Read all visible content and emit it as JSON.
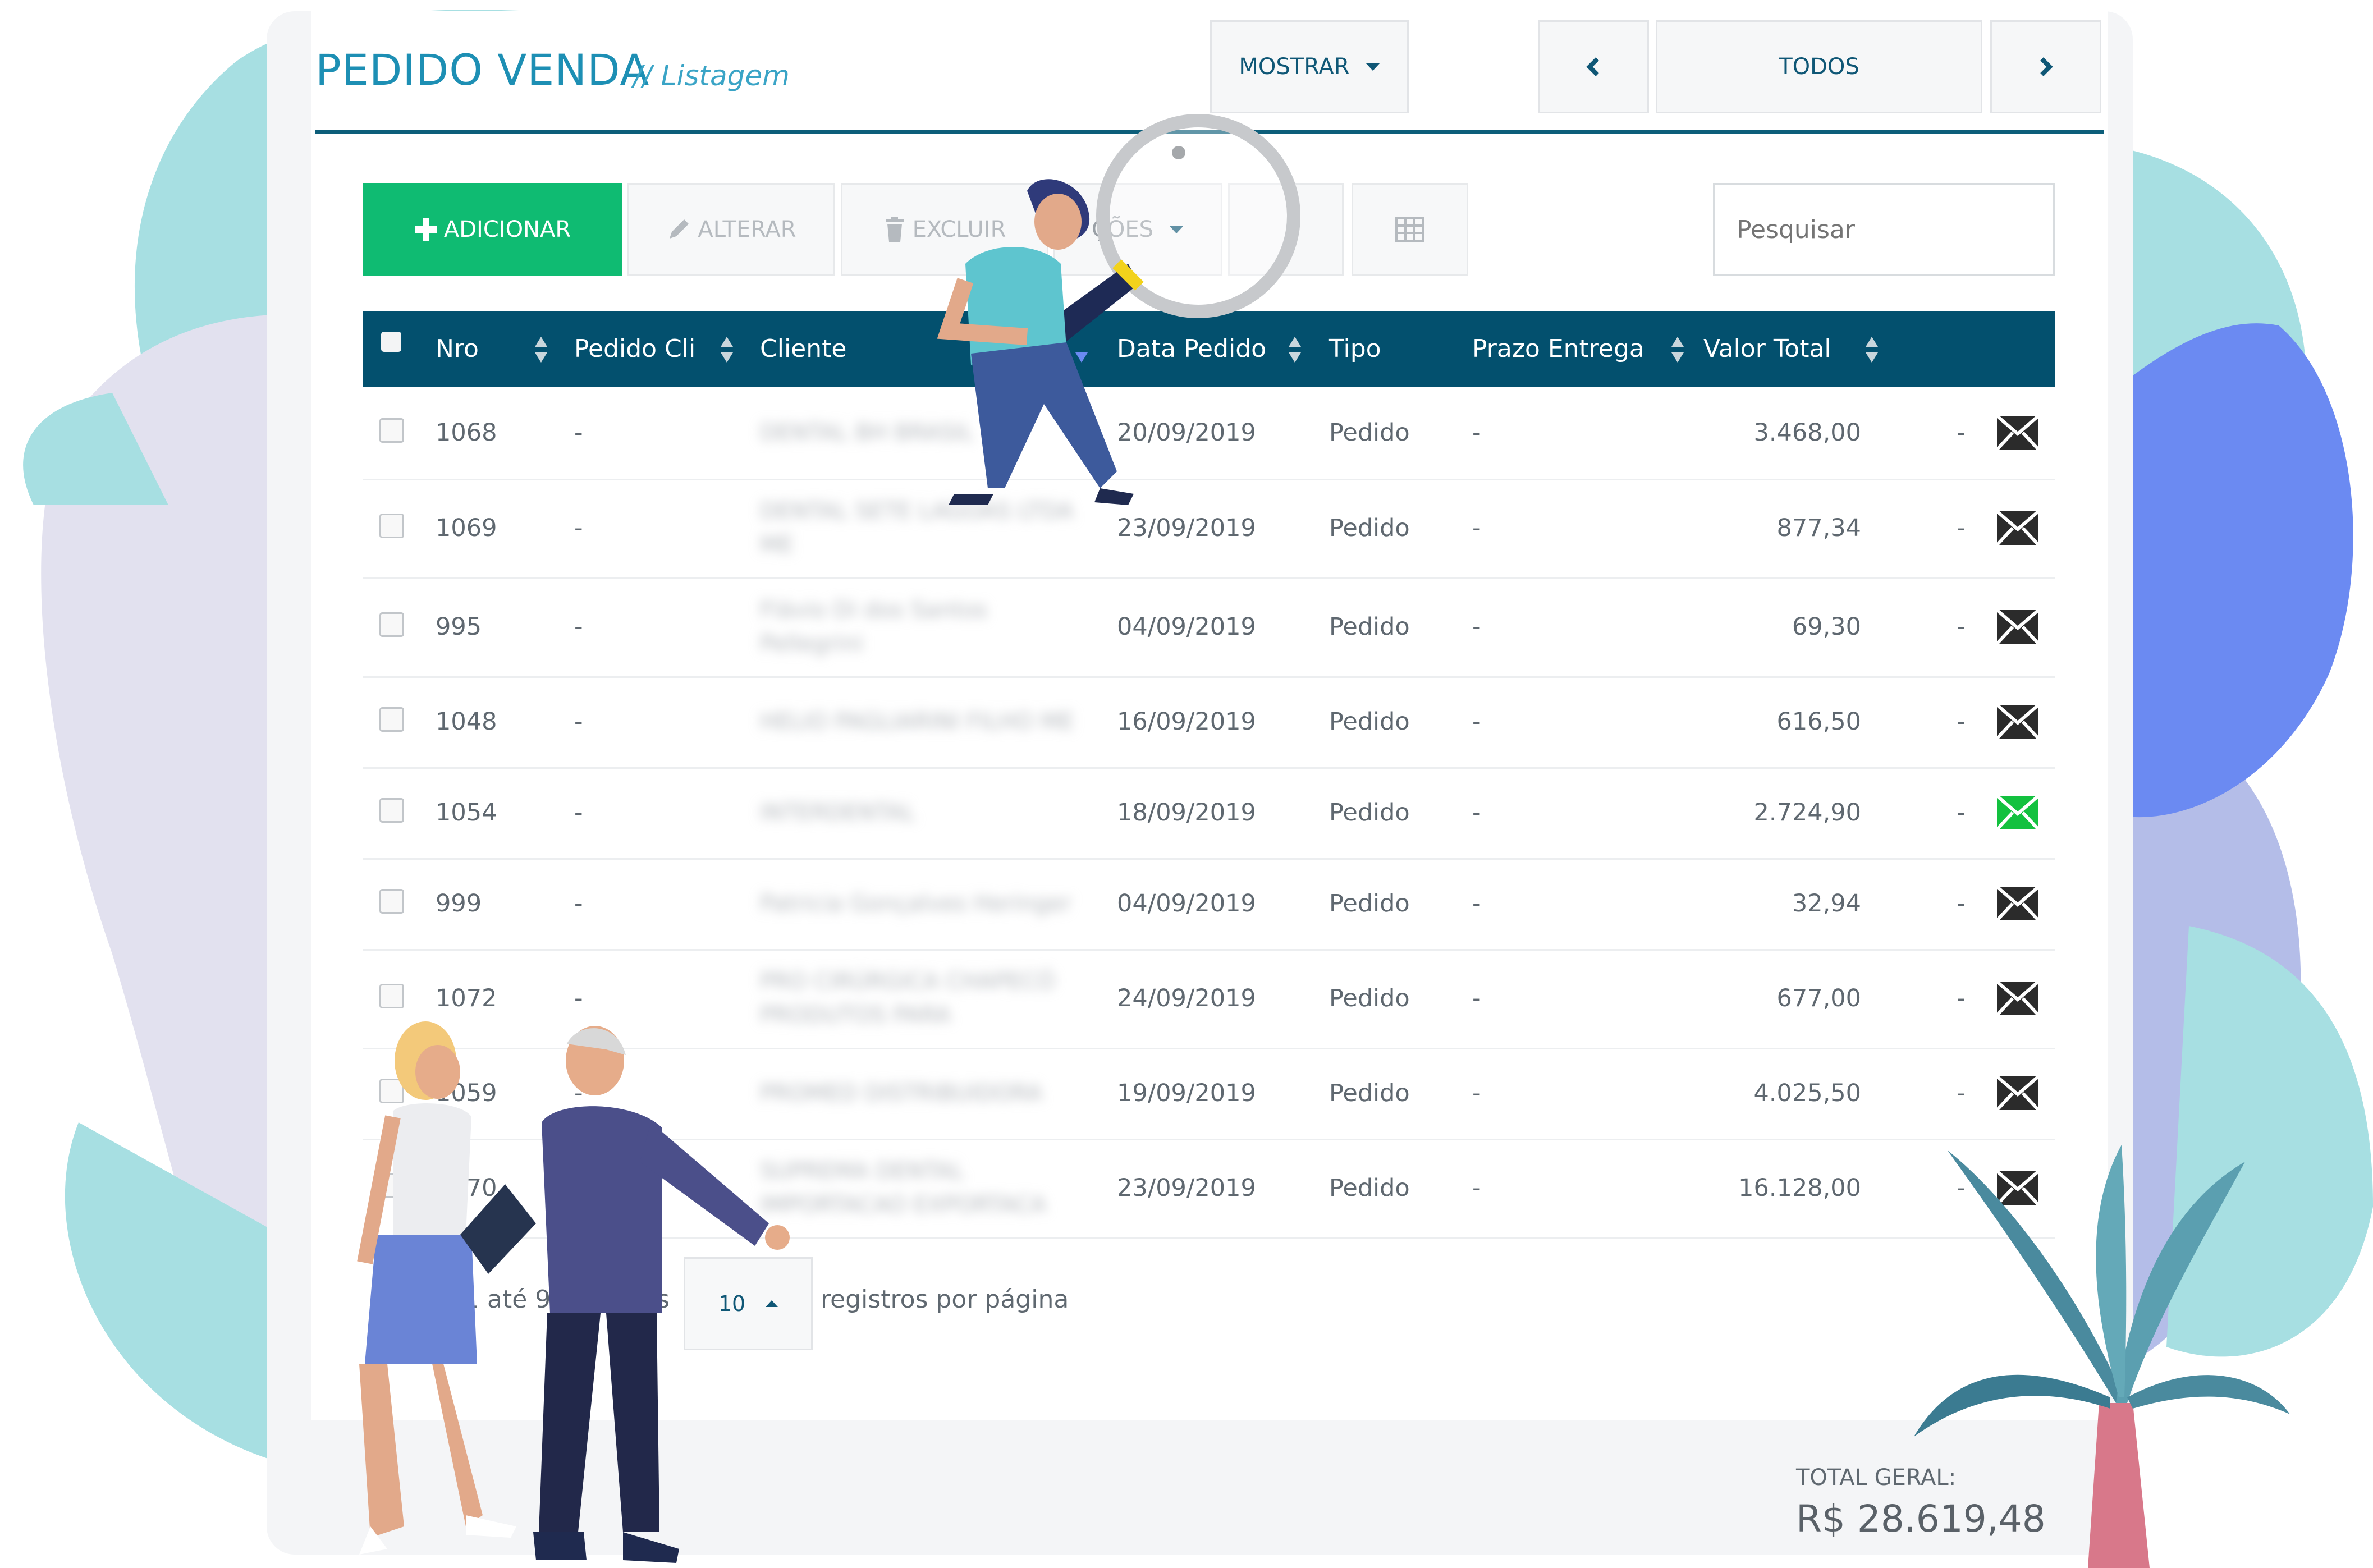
{
  "header": {
    "title": "PEDIDO VENDA",
    "subtitle": "// Listagem",
    "mostrar_label": "MOSTRAR",
    "filter_label": "TODOS"
  },
  "toolbar": {
    "add_label": "ADICIONAR",
    "edit_label": "ALTERAR",
    "delete_label": "EXCLUIR",
    "actions_label": "ÇÕES",
    "search_placeholder": "Pesquisar"
  },
  "table": {
    "columns": [
      "Nro",
      "Pedido Cli",
      "Cliente",
      "Data Pedido",
      "Tipo",
      "Prazo Entrega",
      "Valor Total"
    ],
    "rows": [
      {
        "nro": "1068",
        "pedido_cli": "-",
        "cliente": "DENTAL BH BRASIL",
        "data": "20/09/2019",
        "tipo": "Pedido",
        "prazo": "-",
        "valor": "3.468,00",
        "extra": "-",
        "mail_status": "default"
      },
      {
        "nro": "1069",
        "pedido_cli": "-",
        "cliente": "DENTAL SETE LAGOAS LTDA ME",
        "data": "23/09/2019",
        "tipo": "Pedido",
        "prazo": "-",
        "valor": "877,34",
        "extra": "-",
        "mail_status": "default"
      },
      {
        "nro": "995",
        "pedido_cli": "-",
        "cliente": "Flávio Di dos Santos Pellegrini",
        "data": "04/09/2019",
        "tipo": "Pedido",
        "prazo": "-",
        "valor": "69,30",
        "extra": "-",
        "mail_status": "default"
      },
      {
        "nro": "1048",
        "pedido_cli": "-",
        "cliente": "HELIO PAGLIARINI FILHO ME",
        "data": "16/09/2019",
        "tipo": "Pedido",
        "prazo": "-",
        "valor": "616,50",
        "extra": "-",
        "mail_status": "default"
      },
      {
        "nro": "1054",
        "pedido_cli": "-",
        "cliente": "INTERDENTAL",
        "data": "18/09/2019",
        "tipo": "Pedido",
        "prazo": "-",
        "valor": "2.724,90",
        "extra": "-",
        "mail_status": "sent"
      },
      {
        "nro": "999",
        "pedido_cli": "-",
        "cliente": "Patricia Gonçalves Heringer",
        "data": "04/09/2019",
        "tipo": "Pedido",
        "prazo": "-",
        "valor": "32,94",
        "extra": "-",
        "mail_status": "default"
      },
      {
        "nro": "1072",
        "pedido_cli": "-",
        "cliente": "PRO CIRÚRGICA CHAPECÓ PRODUTOS PARA",
        "data": "24/09/2019",
        "tipo": "Pedido",
        "prazo": "-",
        "valor": "677,00",
        "extra": "-",
        "mail_status": "default"
      },
      {
        "nro": "1059",
        "pedido_cli": "-",
        "cliente": "PROMED DISTRIBUIDORA",
        "data": "19/09/2019",
        "tipo": "Pedido",
        "prazo": "-",
        "valor": "4.025,50",
        "extra": "-",
        "mail_status": "default"
      },
      {
        "nro": "1070",
        "pedido_cli": "-",
        "cliente": "SUPREMA DENTAL IMPORTACAO EXPORTACA",
        "data": "23/09/2019",
        "tipo": "Pedido",
        "prazo": "-",
        "valor": "16.128,00",
        "extra": "-",
        "mail_status": "default"
      }
    ]
  },
  "footer": {
    "range_text": "1 até 9",
    "range_suffix": "s",
    "page_size": "10",
    "per_page_label": "registros por página",
    "total_label": "TOTAL GERAL:",
    "total_value": "R$ 28.619,48"
  },
  "colors": {
    "brand": "#1d8fb4",
    "header_bg": "#03506e",
    "add_button": "#0fbb72",
    "mail_sent": "#13c13f"
  },
  "icons": {
    "add": "plus-icon",
    "edit": "pencil-icon",
    "delete": "trash-icon",
    "grid": "table-grid-icon",
    "prev": "chevron-left-icon",
    "next": "chevron-right-icon",
    "mail": "envelope-icon",
    "sort": "sort-icon"
  }
}
